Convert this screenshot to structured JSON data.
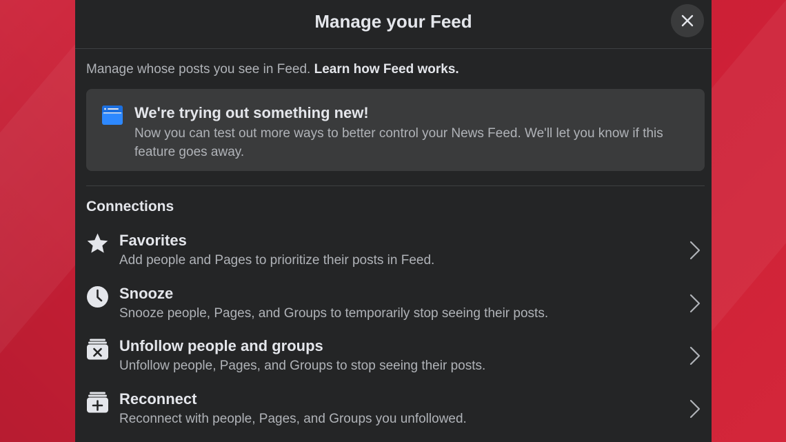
{
  "dialog": {
    "title": "Manage your Feed",
    "close_icon": "close-icon"
  },
  "intro": {
    "text": "Manage whose posts you see in Feed.",
    "link": "Learn how Feed works."
  },
  "notice": {
    "icon": "feed-window-icon",
    "icon_color": "#2d88ff",
    "title": "We're trying out something new!",
    "body": "Now you can test out more ways to better control your News Feed. We'll let you know if this feature goes away."
  },
  "connections": {
    "title": "Connections",
    "items": [
      {
        "icon": "star-icon",
        "label": "Favorites",
        "description": "Add people and Pages to prioritize their posts in Feed."
      },
      {
        "icon": "clock-icon",
        "label": "Snooze",
        "description": "Snooze people, Pages, and Groups to temporarily stop seeing their posts."
      },
      {
        "icon": "unfollow-box-icon",
        "label": "Unfollow people and groups",
        "description": "Unfollow people, Pages, and Groups to stop seeing their posts."
      },
      {
        "icon": "reconnect-box-icon",
        "label": "Reconnect",
        "description": "Reconnect with people, Pages, and Groups you unfollowed."
      }
    ]
  },
  "colors": {
    "background": "#cc1f36",
    "dialog": "#242526",
    "card": "#3a3b3c",
    "primary_text": "#e4e6eb",
    "secondary_text": "#b0b3b8"
  }
}
